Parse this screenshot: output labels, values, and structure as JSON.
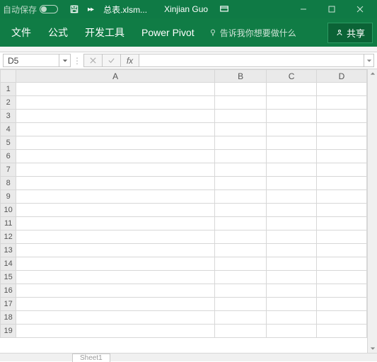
{
  "titlebar": {
    "autosave_label": "自动保存",
    "filename": "总表.xlsm...",
    "username": "Xinjian Guo"
  },
  "ribbon": {
    "tabs": [
      "文件",
      "公式",
      "开发工具",
      "Power Pivot"
    ],
    "tell_me_placeholder": "告诉我你想要做什么",
    "share_label": "共享"
  },
  "formulabar": {
    "namebox": "D5",
    "formula": ""
  },
  "grid": {
    "columns": [
      "A",
      "B",
      "C",
      "D"
    ],
    "rows": [
      "1",
      "2",
      "3",
      "4",
      "5",
      "6",
      "7",
      "8",
      "9",
      "10",
      "11",
      "12",
      "13",
      "14",
      "15",
      "16",
      "17",
      "18",
      "19"
    ]
  },
  "sheets": {
    "active": "Sheet1"
  }
}
